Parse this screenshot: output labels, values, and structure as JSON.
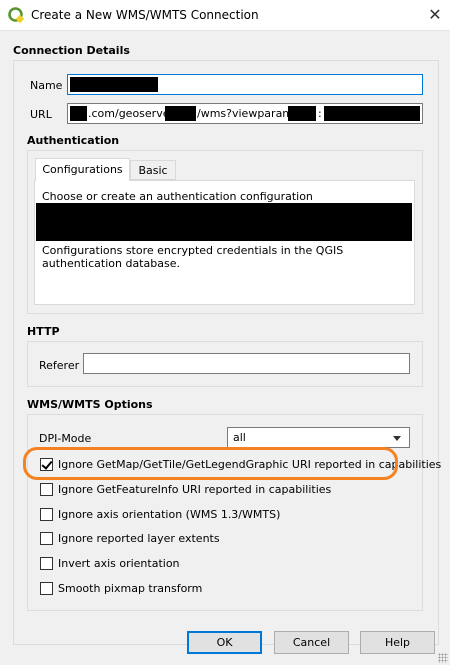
{
  "window": {
    "title": "Create a New WMS/WMTS Connection",
    "close_glyph": "✕"
  },
  "connection": {
    "title": "Connection Details",
    "name_label": "Name",
    "url_label": "URL",
    "url_parts": {
      "domain_suffix": ".com/geoserver/",
      "path": "/wms?viewparams=",
      "sep": ":"
    }
  },
  "auth": {
    "title": "Authentication",
    "tabs": [
      "Configurations",
      "Basic"
    ],
    "active_tab": 0,
    "choose_text": "Choose or create an authentication configuration",
    "info_text": "Configurations store encrypted credentials in the QGIS authentication database."
  },
  "http": {
    "title": "HTTP",
    "referer_label": "Referer",
    "referer_value": ""
  },
  "wms": {
    "title": "WMS/WMTS Options",
    "dpi_label": "DPI-Mode",
    "dpi_value": "all",
    "options": [
      {
        "label": "Ignore GetMap/GetTile/GetLegendGraphic URI reported in capabilities",
        "checked": true
      },
      {
        "label": "Ignore GetFeatureInfo URI reported in capabilities",
        "checked": false
      },
      {
        "label": "Ignore axis orientation (WMS 1.3/WMTS)",
        "checked": false
      },
      {
        "label": "Ignore reported layer extents",
        "checked": false
      },
      {
        "label": "Invert axis orientation",
        "checked": false
      },
      {
        "label": "Smooth pixmap transform",
        "checked": false
      }
    ]
  },
  "buttons": {
    "ok": "OK",
    "cancel": "Cancel",
    "help": "Help"
  },
  "colors": {
    "highlight": "#f58220",
    "focus": "#0078d7",
    "qgis_green": "#589632"
  },
  "icons": {
    "app": "qgis-logo-icon",
    "close": "close-icon",
    "dropdown": "chevron-down-icon",
    "resize": "resize-grip-icon"
  }
}
